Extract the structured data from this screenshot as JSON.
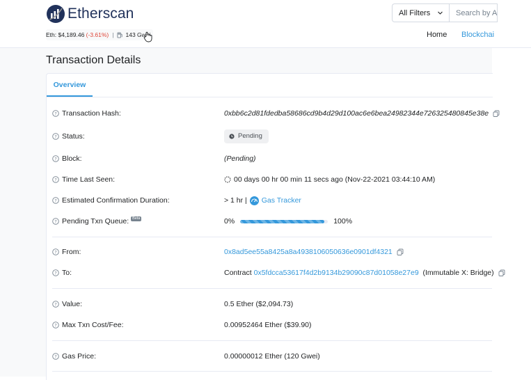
{
  "header": {
    "brand": "Etherscan",
    "price_label": "Eth: $4,189.46",
    "price_change": "(-3.61%)",
    "separator": "|",
    "gas": "143 Gwei",
    "filter_label": "All Filters",
    "search_placeholder": "Search by A",
    "nav": {
      "home": "Home",
      "blockchain": "Blockchai"
    }
  },
  "page": {
    "title": "Transaction Details"
  },
  "tabs": [
    {
      "label": "Overview",
      "active": true
    }
  ],
  "details": {
    "tx_hash": {
      "label": "Transaction Hash:",
      "value": "0xbb6c2d81fdedba58686cd9b4d29d100ac6e6bea24982344e726325480845e38e"
    },
    "status": {
      "label": "Status:",
      "value": "Pending"
    },
    "block": {
      "label": "Block:",
      "value": "(Pending)"
    },
    "time_last_seen": {
      "label": "Time Last Seen:",
      "value": "00 days 00 hr 00 min 11 secs ago (Nov-22-2021 03:44:10 AM)"
    },
    "est_duration": {
      "label": "Estimated Confirmation Duration:",
      "value": "> 1 hr |",
      "link": "Gas Tracker"
    },
    "pending_queue": {
      "label": "Pending Txn Queue:",
      "badge": "Beta",
      "start": "0%",
      "end": "100%",
      "progress_fraction": 0.96
    },
    "from": {
      "label": "From:",
      "value": "0x8ad5ee55a8425a8a4938106050636e0901df4321"
    },
    "to": {
      "label": "To:",
      "prefix": "Contract",
      "address": "0x5fdcca53617f4d2b9134b29090c87d01058e27e9",
      "name": "(Immutable X: Bridge)"
    },
    "value": {
      "label": "Value:",
      "value": "0.5 Ether ($2,094.73)"
    },
    "max_fee": {
      "label": "Max Txn Cost/Fee:",
      "value": "0.00952464 Ether ($39.90)"
    },
    "gas_price": {
      "label": "Gas Price:",
      "value": "0.00000012 Ether (120 Gwei)"
    }
  },
  "colors": {
    "link": "#3498db",
    "negative": "#de4437",
    "brand": "#21325b"
  },
  "icons": [
    "etherscan-logo-icon",
    "gas-pump-icon",
    "cursor-hand-icon",
    "chevron-down-icon",
    "question-circle-icon",
    "copy-icon",
    "clock-icon",
    "spinner-icon",
    "gauge-icon"
  ]
}
